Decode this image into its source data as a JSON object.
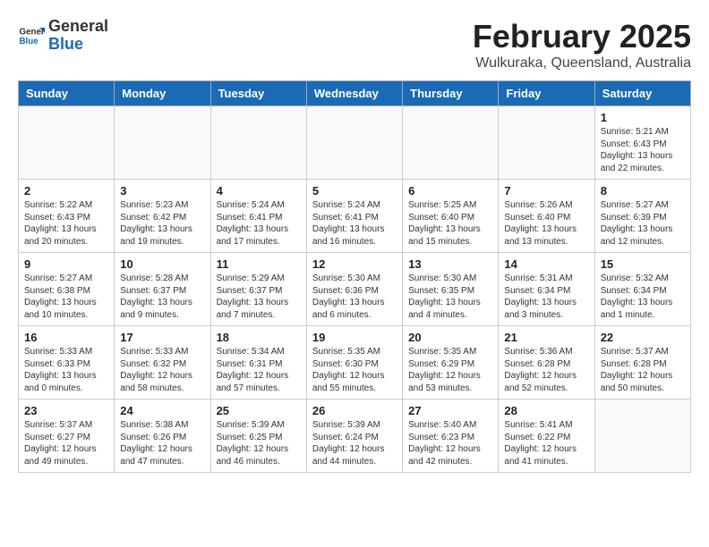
{
  "header": {
    "logo": {
      "general": "General",
      "blue": "Blue"
    },
    "title": "February 2025",
    "subtitle": "Wulkuraka, Queensland, Australia"
  },
  "weekdays": [
    "Sunday",
    "Monday",
    "Tuesday",
    "Wednesday",
    "Thursday",
    "Friday",
    "Saturday"
  ],
  "weeks": [
    [
      {
        "day": "",
        "info": ""
      },
      {
        "day": "",
        "info": ""
      },
      {
        "day": "",
        "info": ""
      },
      {
        "day": "",
        "info": ""
      },
      {
        "day": "",
        "info": ""
      },
      {
        "day": "",
        "info": ""
      },
      {
        "day": "1",
        "info": "Sunrise: 5:21 AM\nSunset: 6:43 PM\nDaylight: 13 hours and 22 minutes."
      }
    ],
    [
      {
        "day": "2",
        "info": "Sunrise: 5:22 AM\nSunset: 6:43 PM\nDaylight: 13 hours and 20 minutes."
      },
      {
        "day": "3",
        "info": "Sunrise: 5:23 AM\nSunset: 6:42 PM\nDaylight: 13 hours and 19 minutes."
      },
      {
        "day": "4",
        "info": "Sunrise: 5:24 AM\nSunset: 6:41 PM\nDaylight: 13 hours and 17 minutes."
      },
      {
        "day": "5",
        "info": "Sunrise: 5:24 AM\nSunset: 6:41 PM\nDaylight: 13 hours and 16 minutes."
      },
      {
        "day": "6",
        "info": "Sunrise: 5:25 AM\nSunset: 6:40 PM\nDaylight: 13 hours and 15 minutes."
      },
      {
        "day": "7",
        "info": "Sunrise: 5:26 AM\nSunset: 6:40 PM\nDaylight: 13 hours and 13 minutes."
      },
      {
        "day": "8",
        "info": "Sunrise: 5:27 AM\nSunset: 6:39 PM\nDaylight: 13 hours and 12 minutes."
      }
    ],
    [
      {
        "day": "9",
        "info": "Sunrise: 5:27 AM\nSunset: 6:38 PM\nDaylight: 13 hours and 10 minutes."
      },
      {
        "day": "10",
        "info": "Sunrise: 5:28 AM\nSunset: 6:37 PM\nDaylight: 13 hours and 9 minutes."
      },
      {
        "day": "11",
        "info": "Sunrise: 5:29 AM\nSunset: 6:37 PM\nDaylight: 13 hours and 7 minutes."
      },
      {
        "day": "12",
        "info": "Sunrise: 5:30 AM\nSunset: 6:36 PM\nDaylight: 13 hours and 6 minutes."
      },
      {
        "day": "13",
        "info": "Sunrise: 5:30 AM\nSunset: 6:35 PM\nDaylight: 13 hours and 4 minutes."
      },
      {
        "day": "14",
        "info": "Sunrise: 5:31 AM\nSunset: 6:34 PM\nDaylight: 13 hours and 3 minutes."
      },
      {
        "day": "15",
        "info": "Sunrise: 5:32 AM\nSunset: 6:34 PM\nDaylight: 13 hours and 1 minute."
      }
    ],
    [
      {
        "day": "16",
        "info": "Sunrise: 5:33 AM\nSunset: 6:33 PM\nDaylight: 13 hours and 0 minutes."
      },
      {
        "day": "17",
        "info": "Sunrise: 5:33 AM\nSunset: 6:32 PM\nDaylight: 12 hours and 58 minutes."
      },
      {
        "day": "18",
        "info": "Sunrise: 5:34 AM\nSunset: 6:31 PM\nDaylight: 12 hours and 57 minutes."
      },
      {
        "day": "19",
        "info": "Sunrise: 5:35 AM\nSunset: 6:30 PM\nDaylight: 12 hours and 55 minutes."
      },
      {
        "day": "20",
        "info": "Sunrise: 5:35 AM\nSunset: 6:29 PM\nDaylight: 12 hours and 53 minutes."
      },
      {
        "day": "21",
        "info": "Sunrise: 5:36 AM\nSunset: 6:28 PM\nDaylight: 12 hours and 52 minutes."
      },
      {
        "day": "22",
        "info": "Sunrise: 5:37 AM\nSunset: 6:28 PM\nDaylight: 12 hours and 50 minutes."
      }
    ],
    [
      {
        "day": "23",
        "info": "Sunrise: 5:37 AM\nSunset: 6:27 PM\nDaylight: 12 hours and 49 minutes."
      },
      {
        "day": "24",
        "info": "Sunrise: 5:38 AM\nSunset: 6:26 PM\nDaylight: 12 hours and 47 minutes."
      },
      {
        "day": "25",
        "info": "Sunrise: 5:39 AM\nSunset: 6:25 PM\nDaylight: 12 hours and 46 minutes."
      },
      {
        "day": "26",
        "info": "Sunrise: 5:39 AM\nSunset: 6:24 PM\nDaylight: 12 hours and 44 minutes."
      },
      {
        "day": "27",
        "info": "Sunrise: 5:40 AM\nSunset: 6:23 PM\nDaylight: 12 hours and 42 minutes."
      },
      {
        "day": "28",
        "info": "Sunrise: 5:41 AM\nSunset: 6:22 PM\nDaylight: 12 hours and 41 minutes."
      },
      {
        "day": "",
        "info": ""
      }
    ]
  ]
}
